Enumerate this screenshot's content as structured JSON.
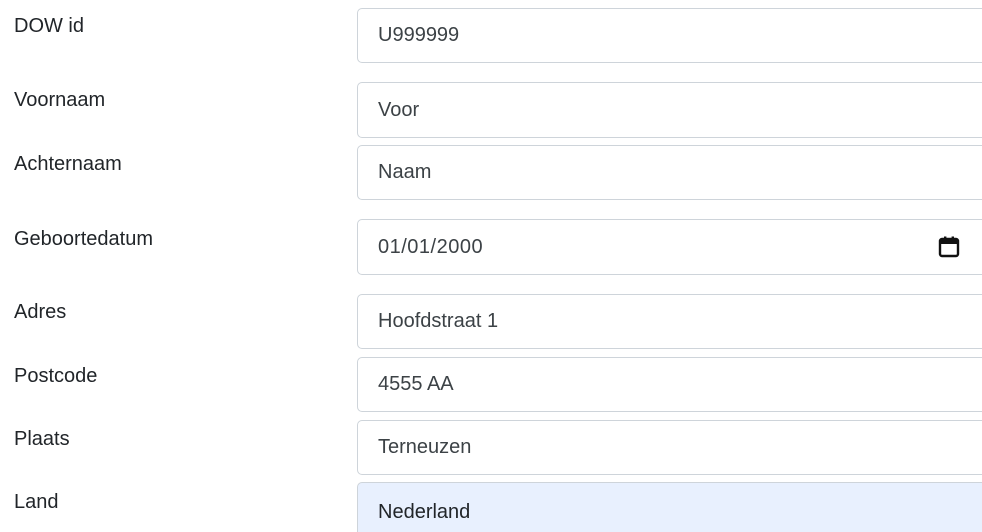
{
  "form": {
    "dow_id": {
      "label": "DOW id",
      "value": "U999999"
    },
    "voornaam": {
      "label": "Voornaam",
      "value": "Voor"
    },
    "achternaam": {
      "label": "Achternaam",
      "value": "Naam"
    },
    "geboortedatum": {
      "label": "Geboortedatum",
      "value": "01/01/2000",
      "icon": "calendar-icon"
    },
    "adres": {
      "label": "Adres",
      "value": "Hoofdstraat 1"
    },
    "postcode": {
      "label": "Postcode",
      "value": "4555 AA"
    },
    "plaats": {
      "label": "Plaats",
      "value": "Terneuzen"
    },
    "land": {
      "label": "Land",
      "value": "Nederland",
      "autofill_color": "#e8f0fe"
    }
  },
  "colors": {
    "border": "#ced4da",
    "text": "#212529",
    "autofill_bg": "#e8f0fe"
  }
}
